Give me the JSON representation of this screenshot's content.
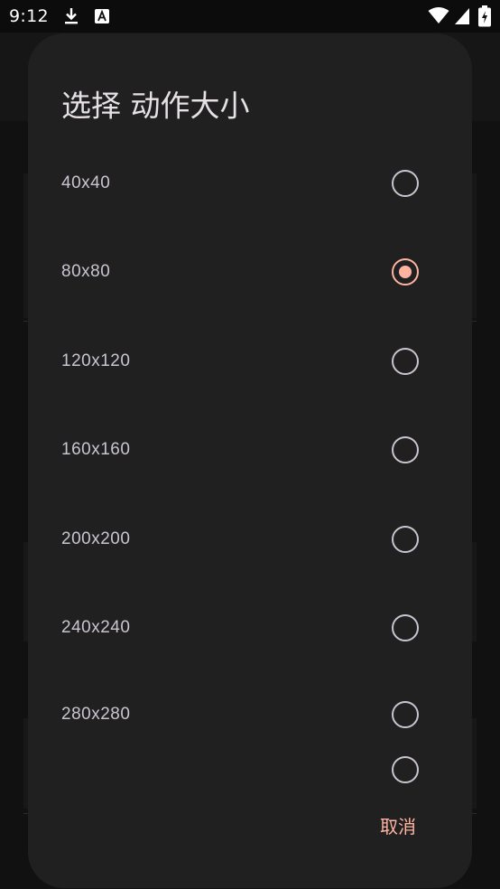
{
  "status_bar": {
    "time": "9:12",
    "left_icons": [
      "download-icon",
      "translate-a-icon"
    ],
    "right_icons": [
      "wifi-icon",
      "signal-icon",
      "battery-icon"
    ]
  },
  "dialog": {
    "title": "选择 动作大小",
    "options": [
      {
        "label": "40x40",
        "selected": false
      },
      {
        "label": "80x80",
        "selected": true
      },
      {
        "label": "120x120",
        "selected": false
      },
      {
        "label": "160x160",
        "selected": false
      },
      {
        "label": "200x200",
        "selected": false
      },
      {
        "label": "240x240",
        "selected": false
      },
      {
        "label": "280x280",
        "selected": false
      },
      {
        "label": "",
        "selected": false
      }
    ],
    "cancel_label": "取消"
  },
  "colors": {
    "accent": "#ffb4a1",
    "dialog_bg": "#202021",
    "text_primary": "#e6e1e5",
    "text_secondary": "#cac4d0"
  }
}
